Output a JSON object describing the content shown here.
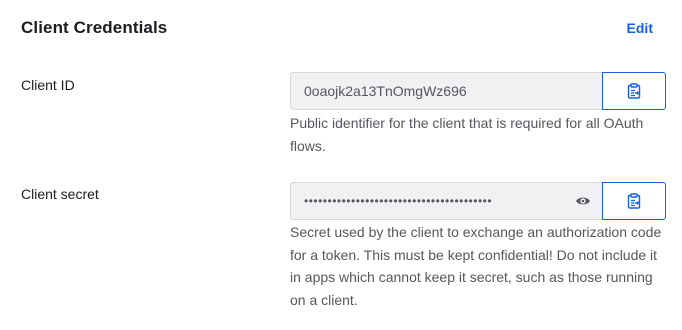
{
  "section": {
    "title": "Client Credentials",
    "edit_label": "Edit"
  },
  "client_id": {
    "label": "Client ID",
    "value": "0oaojk2a13TnOmgWz696",
    "help": "Public identifier for the client that is required for all OAuth flows.",
    "copy_icon": "clipboard-icon"
  },
  "client_secret": {
    "label": "Client secret",
    "masked_value": "••••••••••••••••••••••••••••••••••••••••",
    "help": "Secret used by the client to exchange an authorization code for a token. This must be kept confidential! Do not include it in apps which cannot keep it secret, such as those running on a client.",
    "reveal_icon": "eye-icon",
    "copy_icon": "clipboard-icon"
  },
  "colors": {
    "accent": "#1662dd",
    "text": "#1d1d21",
    "muted": "#55575e",
    "input_bg": "#f0f1f3",
    "input_border": "#d7d8dc"
  }
}
